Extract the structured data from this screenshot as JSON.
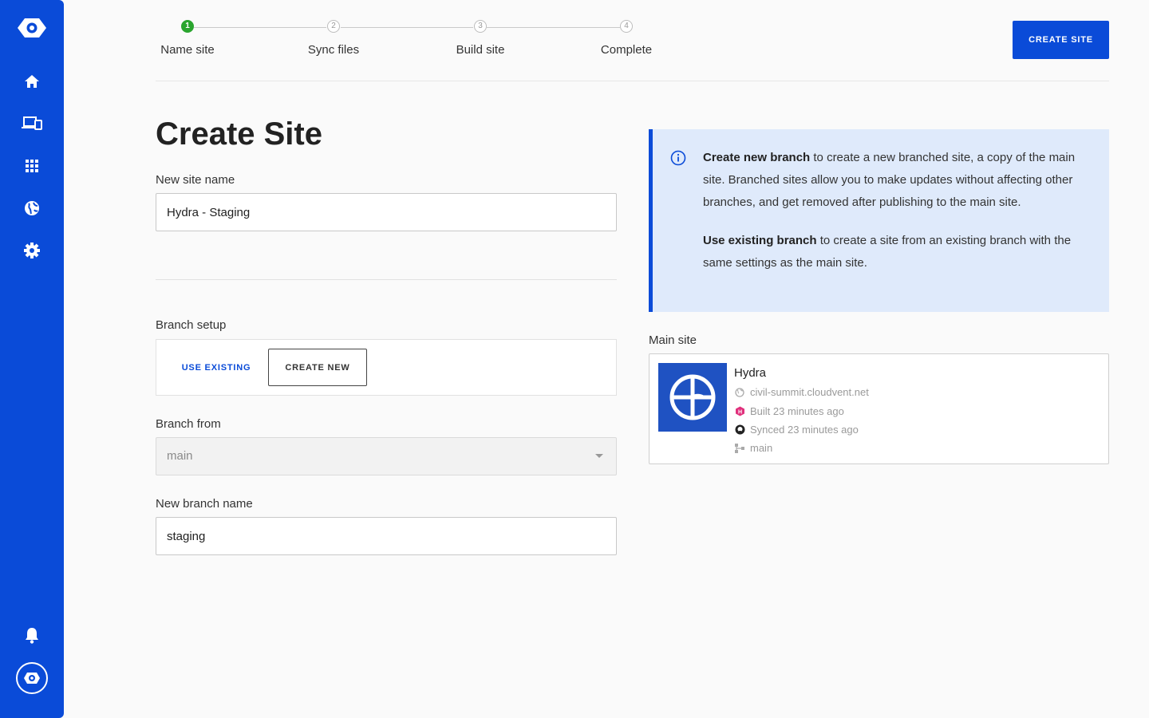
{
  "sidebar": {
    "items": [
      {
        "name": "logo-icon"
      },
      {
        "name": "home-icon"
      },
      {
        "name": "devices-icon"
      },
      {
        "name": "apps-grid-icon"
      },
      {
        "name": "globe-icon"
      },
      {
        "name": "gear-icon"
      },
      {
        "name": "bell-icon"
      },
      {
        "name": "account-icon"
      }
    ],
    "color": "#0a4bd8"
  },
  "stepper": {
    "steps": [
      {
        "number": "1",
        "label": "Name site",
        "active": true
      },
      {
        "number": "2",
        "label": "Sync files",
        "active": false
      },
      {
        "number": "3",
        "label": "Build site",
        "active": false
      },
      {
        "number": "4",
        "label": "Complete",
        "active": false
      }
    ],
    "active_color": "#2aa52e"
  },
  "header": {
    "create_site_label": "CREATE SITE"
  },
  "form": {
    "title": "Create Site",
    "site_name_label": "New site name",
    "site_name_value": "Hydra - Staging",
    "branch_setup_label": "Branch setup",
    "use_existing_label": "USE EXISTING",
    "create_new_label": "CREATE NEW",
    "branch_from_label": "Branch from",
    "branch_from_value": "main",
    "new_branch_label": "New branch name",
    "new_branch_value": "staging"
  },
  "info": {
    "p1_bold": "Create new branch",
    "p1_text": " to create a new branched site, a copy of the main site. Branched sites allow you to make updates without affecting other branches, and get removed after publishing to the main site.",
    "p2_bold": "Use existing branch",
    "p2_text": " to create a site from an existing branch with the same settings as the main site."
  },
  "main_site": {
    "label": "Main site",
    "name": "Hydra",
    "url": "civil-summit.cloudvent.net",
    "built": "Built 23 minutes ago",
    "synced": "Synced 23 minutes ago",
    "branch": "main"
  },
  "accent": "#0a4bd8"
}
